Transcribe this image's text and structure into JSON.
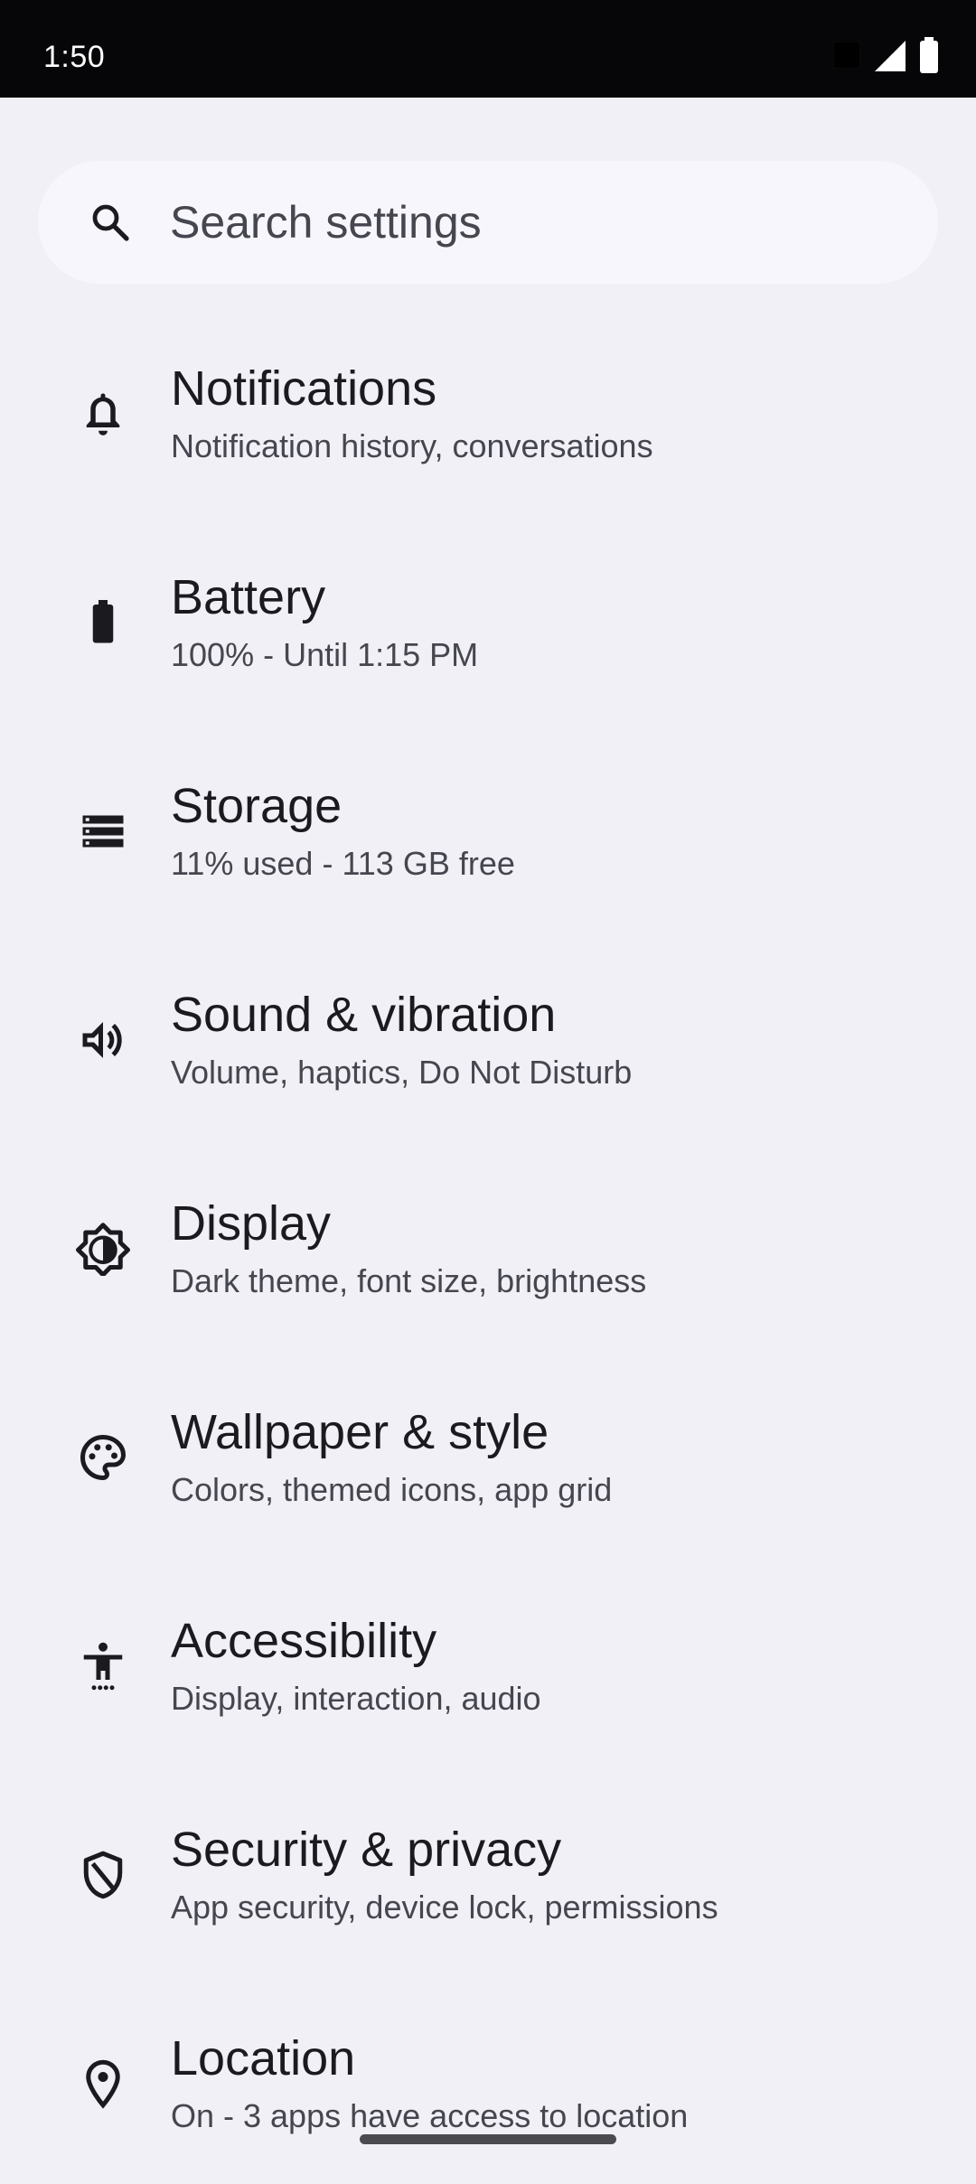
{
  "status_bar": {
    "time": "1:50",
    "icons": [
      "notification-square-icon",
      "cellular-signal-icon",
      "battery-icon"
    ]
  },
  "search": {
    "placeholder": "Search settings",
    "icon": "search-icon"
  },
  "settings": [
    {
      "title": "Notifications",
      "subtitle": "Notification history, conversations",
      "icon": "bell-icon"
    },
    {
      "title": "Battery",
      "subtitle": "100% - Until 1:15 PM",
      "icon": "battery-icon"
    },
    {
      "title": "Storage",
      "subtitle": "11% used - 113 GB free",
      "icon": "storage-icon"
    },
    {
      "title": "Sound & vibration",
      "subtitle": "Volume, haptics, Do Not Disturb",
      "icon": "speaker-icon"
    },
    {
      "title": "Display",
      "subtitle": "Dark theme, font size, brightness",
      "icon": "brightness-icon"
    },
    {
      "title": "Wallpaper & style",
      "subtitle": "Colors, themed icons, app grid",
      "icon": "palette-icon"
    },
    {
      "title": "Accessibility",
      "subtitle": "Display, interaction, audio",
      "icon": "accessibility-icon"
    },
    {
      "title": "Security & privacy",
      "subtitle": "App security, device lock, permissions",
      "icon": "shield-icon"
    },
    {
      "title": "Location",
      "subtitle": "On - 3 apps have access to location",
      "icon": "location-pin-icon"
    }
  ],
  "colors": {
    "background": "#f1f0f6",
    "status_bar": "#060507",
    "search_bg": "#f7f6fc",
    "title_text": "#1b1b1f",
    "subtitle_text": "#45464f"
  }
}
